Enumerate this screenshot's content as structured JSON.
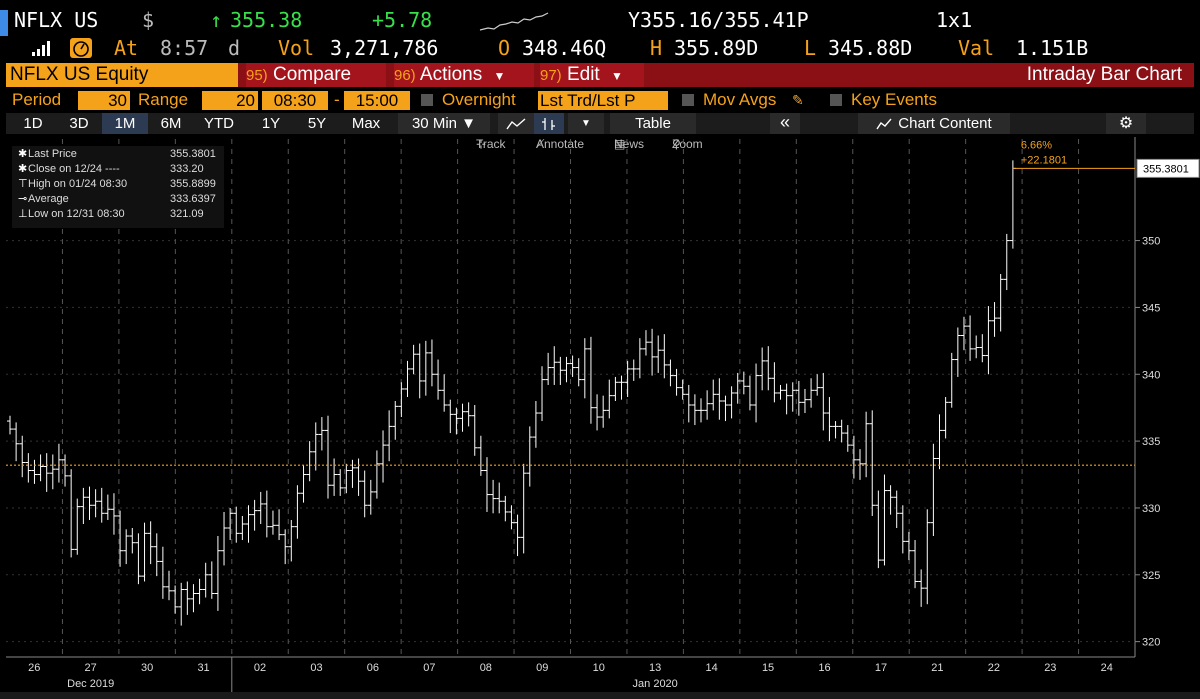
{
  "header": {
    "ticker": "NFLX US",
    "currency": "$",
    "arrow": "↑",
    "last": "355.38",
    "change": "+5.78",
    "bid_ask": "Y355.16/355.41P",
    "size": "1x1"
  },
  "stats": {
    "at_label": "At",
    "time": "8:57",
    "time_suffix": "d",
    "vol_label": "Vol",
    "vol": "3,271,786",
    "open_label": "O",
    "open": "348.46Q",
    "high_label": "H",
    "high": "355.89D",
    "low_label": "L",
    "low": "345.88D",
    "val_label": "Val",
    "val": "1.151B"
  },
  "fbar": {
    "security": "NFLX US Equity",
    "compare_num": "95)",
    "compare": "Compare",
    "actions_num": "96)",
    "actions": "Actions",
    "edit_num": "97)",
    "edit": "Edit",
    "chart_title": "Intraday Bar Chart"
  },
  "params": {
    "period_label": "Period",
    "period": "30",
    "range_label": "Range",
    "range": "20",
    "start": "08:30",
    "dash": "-",
    "end": "15:00",
    "overnight": "Overnight",
    "lst": "Lst Trd/Lst P",
    "mov_avgs": "Mov Avgs",
    "key_events": "Key Events"
  },
  "timeframes": [
    "1D",
    "3D",
    "1M",
    "6M",
    "YTD",
    "1Y",
    "5Y",
    "Max"
  ],
  "timeframe_selected": "1M",
  "toolbar": {
    "interval": "30 Min ▼",
    "table": "Table",
    "collapse": "«",
    "chart_content": "Chart Content"
  },
  "tools": {
    "track": "Track",
    "annotate": "Annotate",
    "news": "News",
    "zoom": "Zoom"
  },
  "legend": [
    {
      "sym": "✱",
      "label": "Last Price",
      "value": "355.3801"
    },
    {
      "sym": "✱",
      "label": "Close on 12/24 ----",
      "value": "333.20"
    },
    {
      "sym": "⊤",
      "label": "High on 01/24 08:30",
      "value": "355.8899"
    },
    {
      "sym": "⊸",
      "label": "Average",
      "value": "333.6397"
    },
    {
      "sym": "⊥",
      "label": "Low on 12/31 08:30",
      "value": "321.09"
    }
  ],
  "annotation": {
    "pct": "6.66%",
    "abs": "+22.1801",
    "last_tag": "355.3801"
  },
  "chart_data": {
    "type": "ohlc",
    "ylim": [
      319,
      357
    ],
    "yticks": [
      320,
      325,
      330,
      335,
      340,
      345,
      350
    ],
    "reference_line": 333.2,
    "x_labels": [
      "26",
      "27",
      "30",
      "31",
      "02",
      "03",
      "06",
      "07",
      "08",
      "09",
      "10",
      "13",
      "14",
      "15",
      "16",
      "17",
      "21",
      "22",
      "23",
      "24"
    ],
    "month_labels": [
      {
        "label": "Dec 2019",
        "day": "27"
      },
      {
        "label": "Jan 2020",
        "day": "13"
      }
    ],
    "closes": [
      335.9,
      334.8,
      333.4,
      332.8,
      332.5,
      333.1,
      332.6,
      332.9,
      333.6,
      332.4,
      326.9,
      330.1,
      330.8,
      330.2,
      330.5,
      329.6,
      329.9,
      329.4,
      326.8,
      327.9,
      327.4,
      324.9,
      328.1,
      327.1,
      326.0,
      324.1,
      323.8,
      322.6,
      323.9,
      323.2,
      323.6,
      323.9,
      325.0,
      323.6,
      326.8,
      328.5,
      329.6,
      328.1,
      328.8,
      329.5,
      329.8,
      330.3,
      328.6,
      328.7,
      328.0,
      327.1,
      328.6,
      331.1,
      332.5,
      334.2,
      335.5,
      335.8,
      331.7,
      332.5,
      331.5,
      332.8,
      333.0,
      332.0,
      330.2,
      331.2,
      333.3,
      334.7,
      336.1,
      337.6,
      338.9,
      340.4,
      341.5,
      339.5,
      341.6,
      340.0,
      338.8,
      337.7,
      337.0,
      336.7,
      337.2,
      336.9,
      334.5,
      332.8,
      331.0,
      330.7,
      330.5,
      329.7,
      328.9,
      327.8,
      332.6,
      335.3,
      337.1,
      339.6,
      340.5,
      340.9,
      340.3,
      340.8,
      340.5,
      339.6,
      341.9,
      337.5,
      336.8,
      337.3,
      338.4,
      339.4,
      339.4,
      340.4,
      340.4,
      341.9,
      342.4,
      341.3,
      341.8,
      340.7,
      339.9,
      339.0,
      338.5,
      337.7,
      337.3,
      337.3,
      337.8,
      338.5,
      338.0,
      337.7,
      338.6,
      339.5,
      339.1,
      337.7,
      339.9,
      341.0,
      339.7,
      338.6,
      338.8,
      338.4,
      338.8,
      337.9,
      338.1,
      338.8,
      339.0,
      337.1,
      336.1,
      336.1,
      335.6,
      334.7,
      333.6,
      333.3,
      336.3,
      330.2,
      326.1,
      331.3,
      330.8,
      329.6,
      327.5,
      326.8,
      324.5,
      324.0,
      328.9,
      333.7,
      335.8,
      337.9,
      341.1,
      342.9,
      343.6,
      341.9,
      342.0,
      341.4,
      344.0,
      344.2,
      347.1,
      350.0,
      355.4
    ]
  }
}
